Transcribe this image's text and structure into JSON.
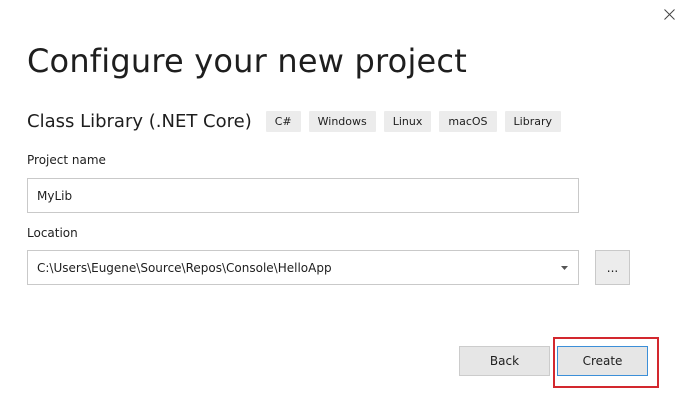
{
  "dialog": {
    "title": "Configure your new project",
    "close_icon": "close-icon"
  },
  "template": {
    "name": "Class Library (.NET Core)",
    "tags": [
      "C#",
      "Windows",
      "Linux",
      "macOS",
      "Library"
    ]
  },
  "project_name": {
    "label": "Project name",
    "value": "MyLib"
  },
  "location": {
    "label": "Location",
    "value": "C:\\Users\\Eugene\\Source\\Repos\\Console\\HelloApp",
    "dropdown_icon": "chevron-down-icon",
    "browse_label": "..."
  },
  "buttons": {
    "back_label": "Back",
    "create_label": "Create"
  },
  "colors": {
    "highlight": "#d3282e",
    "primary_border": "#3c8fd8"
  }
}
